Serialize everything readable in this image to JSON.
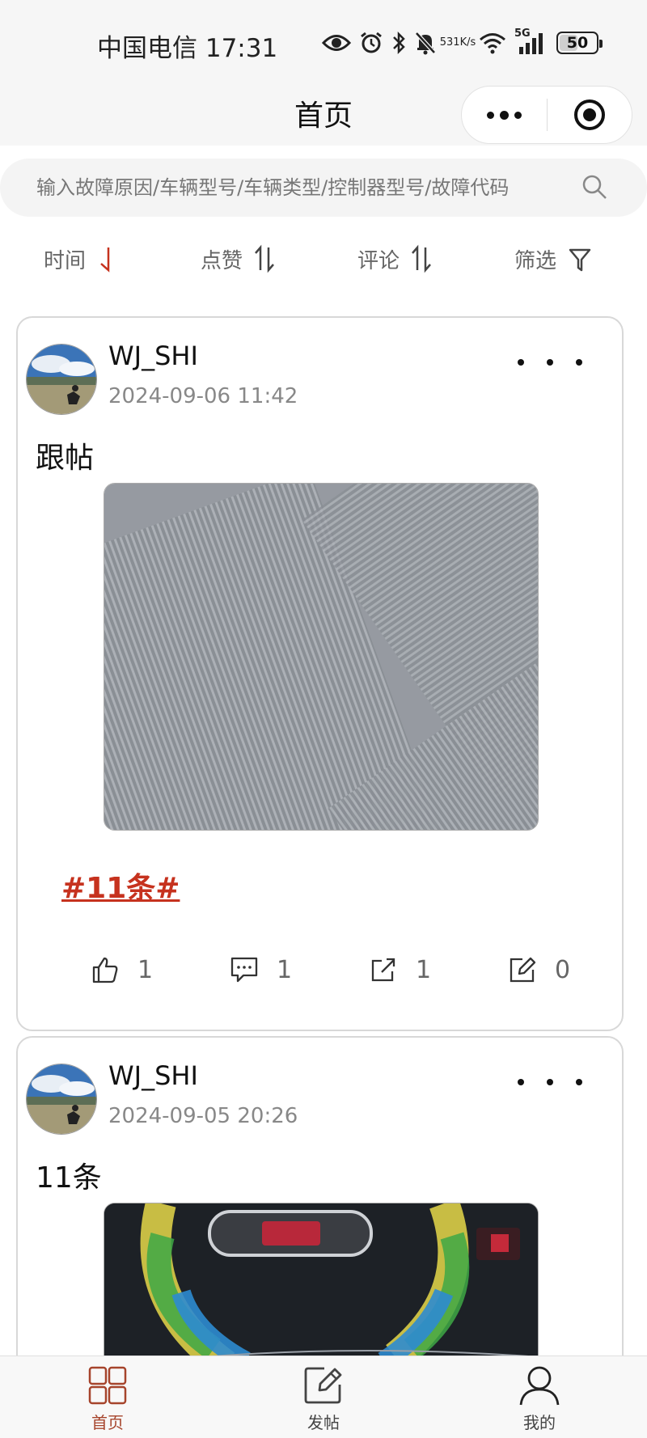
{
  "status_bar": {
    "carrier_time": "中国电信 17:31",
    "net_speed_value": "531",
    "net_speed_unit": "K/s",
    "network_type": "5G",
    "battery": "50",
    "battery_level": 0.5,
    "icons": [
      "eye-icon",
      "alarm-icon",
      "bluetooth-icon",
      "mute-icon",
      "wifi-icon",
      "signal-icon",
      "battery-icon"
    ]
  },
  "nav": {
    "title": "首页"
  },
  "search": {
    "placeholder": "输入故障原因/车辆型号/车辆类型/控制器型号/故障代码"
  },
  "sort": {
    "time": "时间",
    "likes": "点赞",
    "comments": "评论",
    "filter": "筛选",
    "active_color": "#c6321e"
  },
  "posts": [
    {
      "author": "WJ_SHI",
      "time": "2024-09-06 11:42",
      "text": "跟帖",
      "tag": "#11条#",
      "likes": "1",
      "comments": "1",
      "shares": "1",
      "edits": "0"
    },
    {
      "author": "WJ_SHI",
      "time": "2024-09-05 20:26",
      "text": "11条"
    }
  ],
  "tabbar": {
    "home": "首页",
    "post": "发帖",
    "mine": "我的",
    "active_color": "#a6442c"
  }
}
